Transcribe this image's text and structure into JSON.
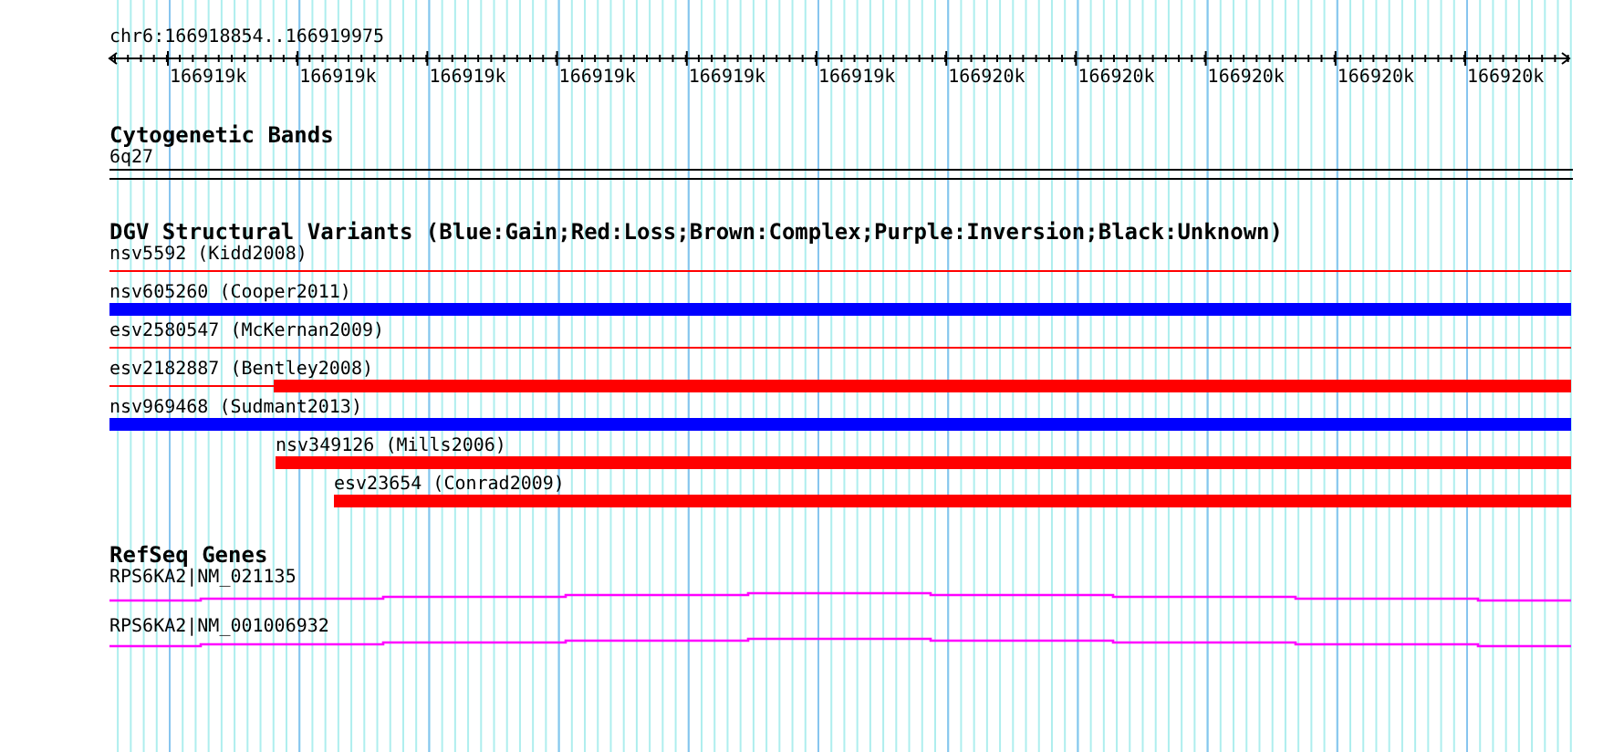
{
  "ruler": {
    "location": "chr6:166918854..166919975",
    "tick_labels": [
      "166919k",
      "166919k",
      "166919k",
      "166919k",
      "166919k",
      "166919k",
      "166920k",
      "166920k",
      "166920k",
      "166920k",
      "166920k"
    ]
  },
  "cytobands": {
    "title": "Cytogenetic Bands",
    "band": "6q27"
  },
  "variants": {
    "title": "DGV Structural Variants (Blue:Gain;Red:Loss;Brown:Complex;Purple:Inversion;Black:Unknown)",
    "features": [
      {
        "label": "nsv5592 (Kidd2008)",
        "kind": "thin",
        "color": "#ff0000"
      },
      {
        "label": "nsv605260 (Cooper2011)",
        "kind": "bar",
        "color": "#0000ff"
      },
      {
        "label": "esv2580547 (McKernan2009)",
        "kind": "thin",
        "color": "#ff0000"
      },
      {
        "label": "esv2182887 (Bentley2008)",
        "kind": "bar",
        "color": "#ff0000"
      },
      {
        "label": "nsv969468 (Sudmant2013)",
        "kind": "bar",
        "color": "#0000ff"
      },
      {
        "label": "nsv349126 (Mills2006)",
        "kind": "bar",
        "color": "#ff0000"
      },
      {
        "label": "esv23654 (Conrad2009)",
        "kind": "bar",
        "color": "#ff0000"
      }
    ]
  },
  "genes": {
    "title": "RefSeq Genes",
    "features": [
      {
        "label": "RPS6KA2|NM_021135"
      },
      {
        "label": "RPS6KA2|NM_001006932"
      }
    ]
  }
}
